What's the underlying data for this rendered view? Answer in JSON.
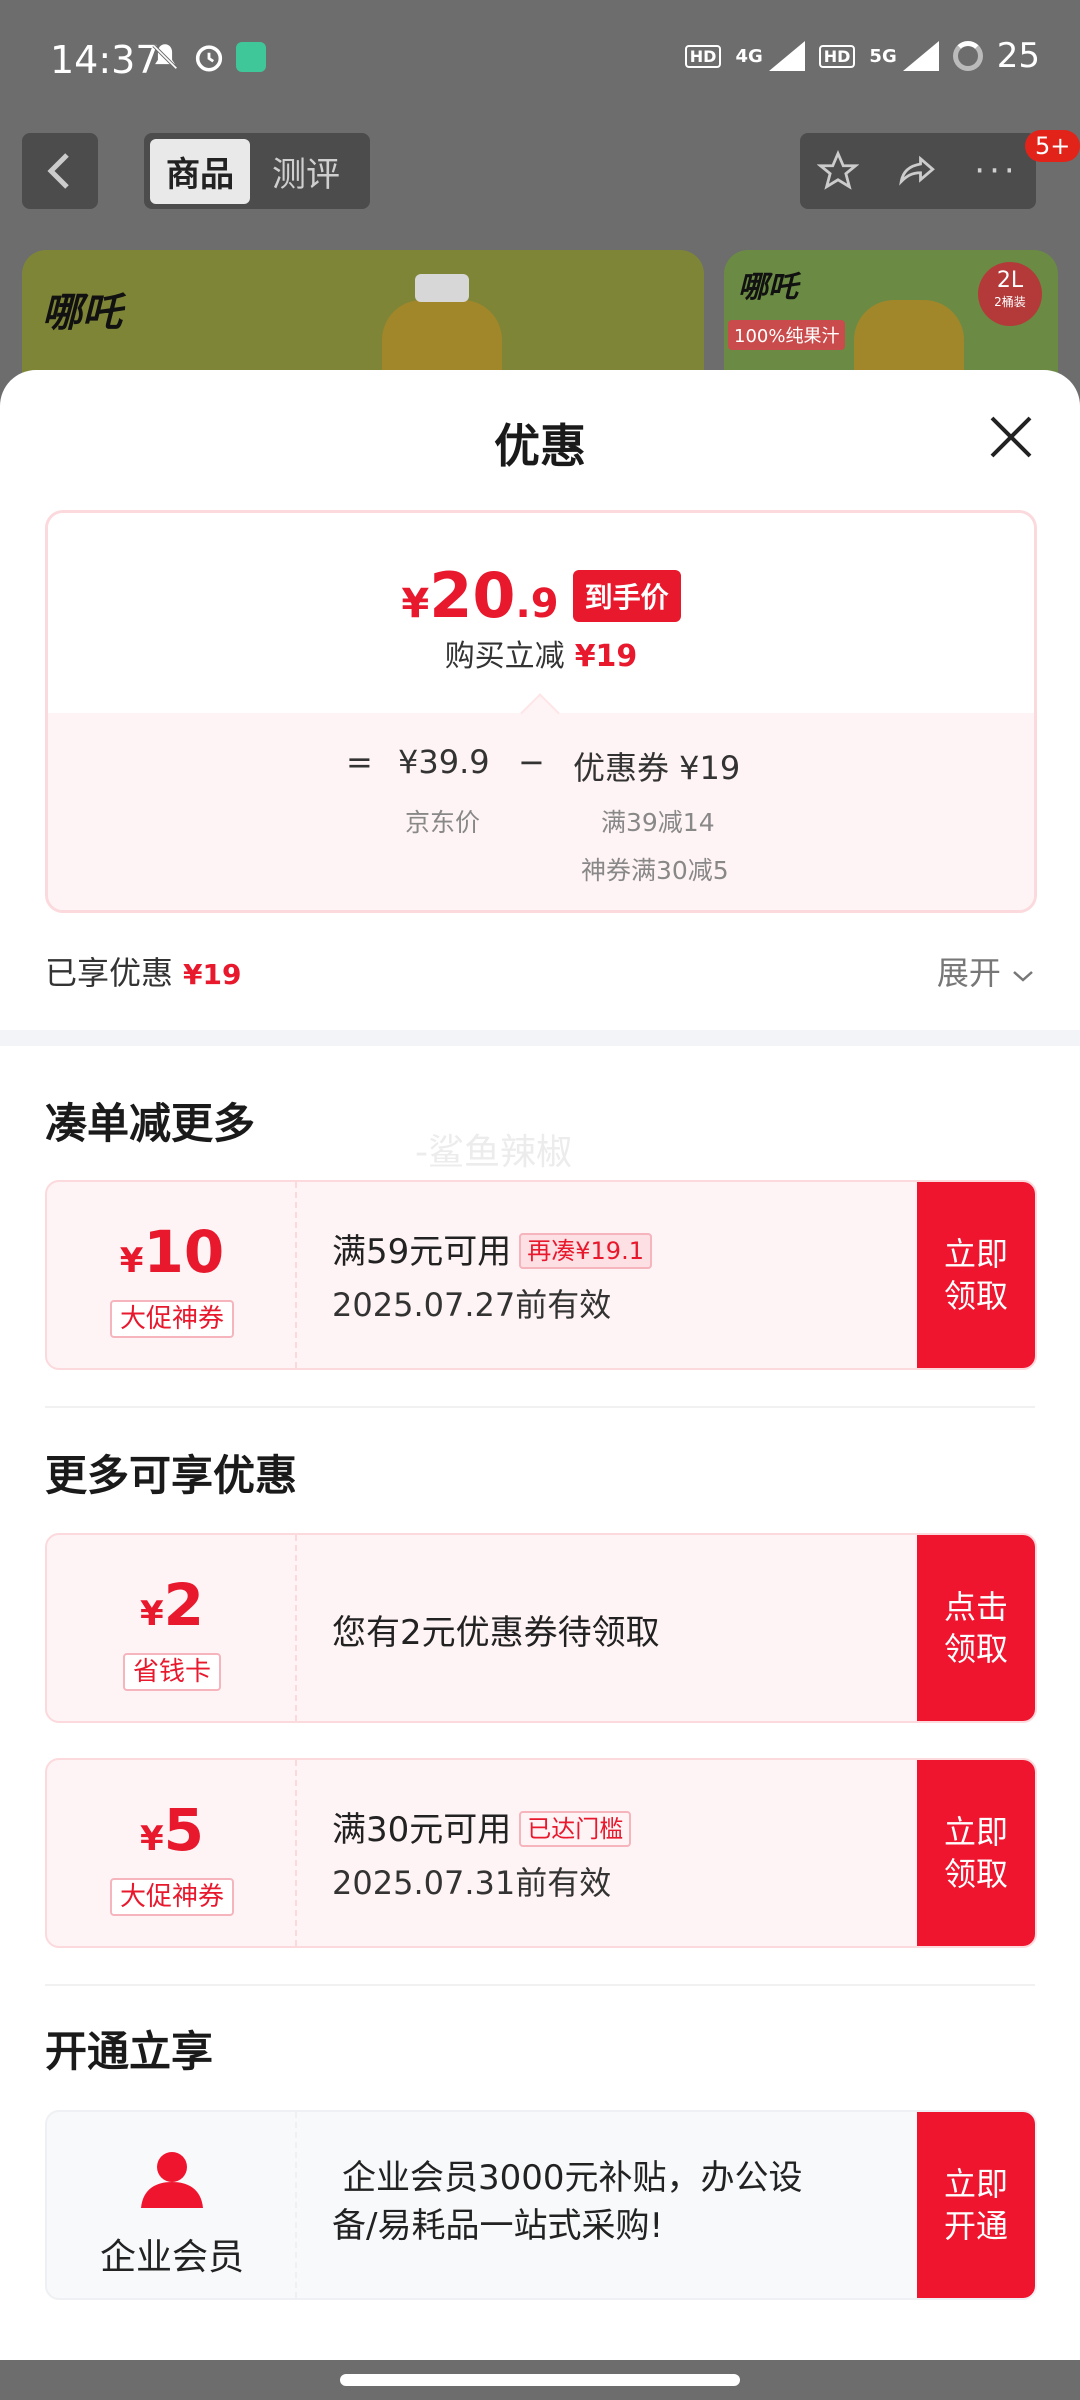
{
  "status_bar": {
    "time": "14:37",
    "net1": "4G",
    "net2": "5G",
    "battery": "25"
  },
  "nav": {
    "tab_goods": "商品",
    "tab_review": "测评",
    "more_badge": "5+"
  },
  "background_products": {
    "brand": "哪吒",
    "tag1": "100%纯果汁",
    "size": "2L",
    "size_note": "2桶装"
  },
  "sheet": {
    "title": "优惠",
    "final_price": {
      "yen": "¥",
      "int": "20",
      "dec": ".9",
      "tag": "到手价"
    },
    "reduce_text": "购买立减",
    "reduce_amount": "¥19",
    "formula": {
      "eq": "=",
      "base": "¥39.9",
      "minus": "−",
      "coupon": "优惠券 ¥19",
      "base_label": "京东价",
      "coupon_detail1": "满39减14",
      "coupon_detail2": "神券满30减5"
    },
    "enjoyed_label": "已享优惠",
    "enjoyed_amount": "¥19",
    "expand": "展开"
  },
  "watermark": "-鲨鱼辣椒",
  "section1": {
    "title": "凑单减更多",
    "coupon": {
      "yen": "¥",
      "amount": "10",
      "type": "大促神券",
      "cond": "满59元可用",
      "chip": "再凑¥19.1",
      "date": "2025.07.27前有效",
      "btn1": "立即",
      "btn2": "领取"
    }
  },
  "section2": {
    "title": "更多可享优惠",
    "coupon1": {
      "yen": "¥",
      "amount": "2",
      "type": "省钱卡",
      "desc": "您有2元优惠券待领取",
      "btn1": "点击",
      "btn2": "领取"
    },
    "coupon2": {
      "yen": "¥",
      "amount": "5",
      "type": "大促神券",
      "cond": "满30元可用",
      "chip": "已达门槛",
      "date": "2025.07.31前有效",
      "btn1": "立即",
      "btn2": "领取"
    }
  },
  "section3": {
    "title": "开通立享",
    "member": {
      "label": "企业会员",
      "desc1": "企业会员3000元补贴，办公设",
      "desc2": "备/易耗品一站式采购!",
      "btn1": "立即",
      "btn2": "开通"
    }
  }
}
